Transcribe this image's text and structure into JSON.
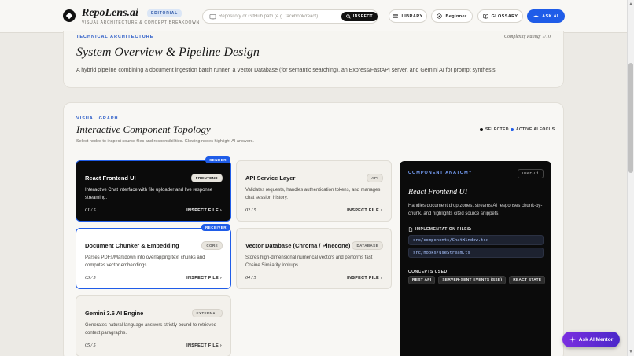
{
  "header": {
    "brand": "RepoLens.ai",
    "badge": "EDITORIAL",
    "subtitle": "VISUAL ARCHITECTURE & CONCEPT BREAKDOWN",
    "search_placeholder": "Repository or GitHub path (e.g. facebook/react)...",
    "inspect_label": "INSPECT",
    "library_label": "LIBRARY",
    "level_label": "Beginner",
    "glossary_label": "GLOSSARY",
    "ask_ai_label": "ASK AI"
  },
  "overview": {
    "eyebrow": "TECHNICAL ARCHITECTURE",
    "complexity": "Complexity Rating: 7/10",
    "title": "System Overview & Pipeline Design",
    "description": "A hybrid pipeline combining a document ingestion batch runner, a Vector Database (for semantic searching), an Express/FastAPI server, and Gemini AI for prompt synthesis."
  },
  "graph": {
    "eyebrow": "VISUAL GRAPH",
    "title": "Interactive Component Topology",
    "subtitle": "Select nodes to inspect source files and responsibilities. Glowing nodes highlight AI answers.",
    "legend_selected": "SELECTED",
    "legend_focus": "ACTIVE AI FOCUS",
    "nodes": [
      {
        "title": "React Frontend UI",
        "tag": "FRONTEND",
        "desc": "Interactive Chat interface with file uploader and live response streaming.",
        "num": "01 / 5",
        "inspect": "INSPECT FILE",
        "badge": "SENDER"
      },
      {
        "title": "API Service Layer",
        "tag": "API",
        "desc": "Validates requests, handles authentication tokens, and manages chat session history.",
        "num": "02 / 5",
        "inspect": "INSPECT FILE"
      },
      {
        "title": "Document Chunker & Embedding",
        "tag": "CORE",
        "desc": "Parses PDFs/Markdown into overlapping text chunks and computes vector embeddings.",
        "num": "03 / 5",
        "inspect": "INSPECT FILE",
        "badge": "RECEIVER"
      },
      {
        "title": "Vector Database (Chroma / Pinecone)",
        "tag": "DATABASE",
        "desc": "Stores high-dimensional numerical vectors and performs fast Cosine Similarity lookups.",
        "num": "04 / 5",
        "inspect": "INSPECT FILE"
      },
      {
        "title": "Gemini 3.6 AI Engine",
        "tag": "EXTERNAL",
        "desc": "Generates natural language answers strictly bound to retrieved context paragraphs.",
        "num": "05 / 5",
        "inspect": "INSPECT FILE"
      }
    ]
  },
  "anatomy": {
    "eyebrow": "COMPONENT ANATOMY",
    "tag": "user-ui",
    "title": "React Frontend UI",
    "description": "Handles document drop zones, streams AI responses chunk-by-chunk, and highlights cited source snippets.",
    "files_label": "IMPLEMENTATION FILES:",
    "files": [
      "src/components/ChatWindow.tsx",
      "src/hooks/useStream.ts"
    ],
    "concepts_label": "CONCEPTS USED:",
    "concepts": [
      "REST API",
      "SERVER-SENT EVENTS (SSE)",
      "REACT STATE"
    ]
  },
  "mentor_label": "Ask AI Mentor",
  "colors": {
    "accent": "#1f5ce8",
    "mentor": "#6a2cd8",
    "dark": "#0b0b0b"
  }
}
